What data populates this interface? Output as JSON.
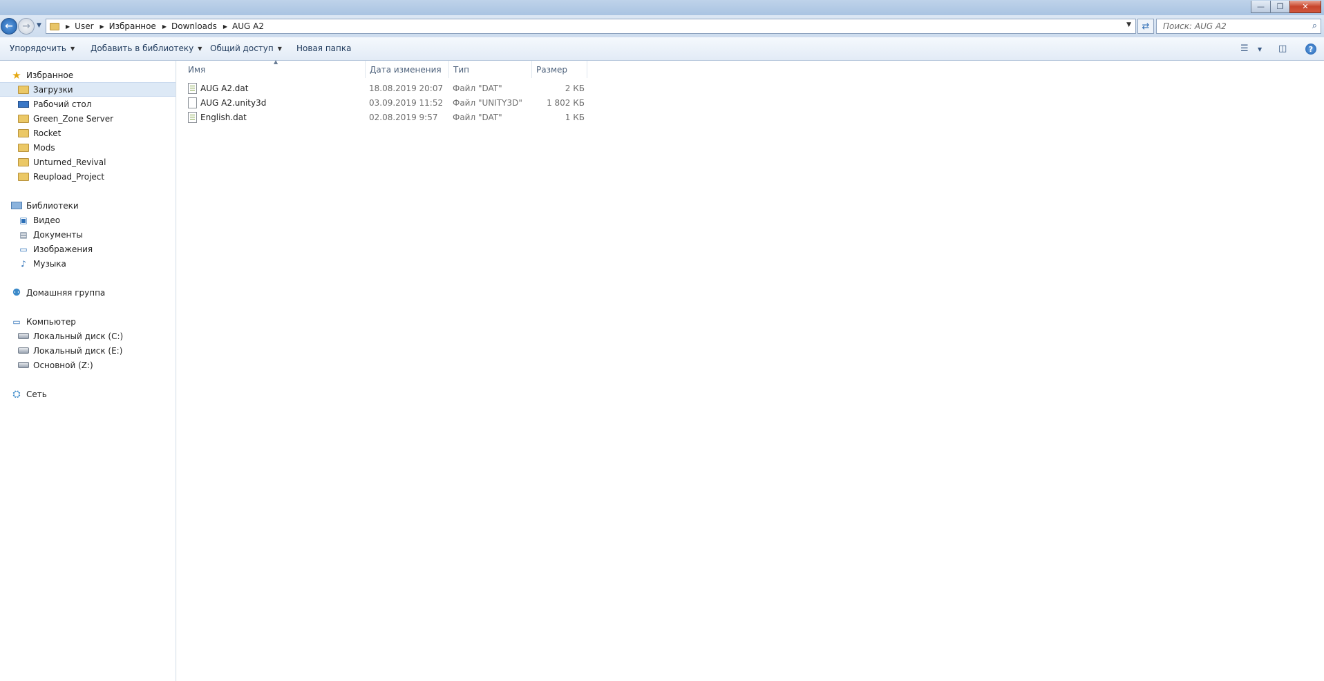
{
  "window": {
    "minimize": "—",
    "maximize": "❐",
    "close": "✕"
  },
  "nav": {
    "back_icon": "arrow-left-icon",
    "forward_icon": "arrow-right-icon",
    "breadcrumbs": [
      "User",
      "Избранное",
      "Downloads",
      "AUG A2"
    ],
    "search_placeholder": "Поиск: AUG A2"
  },
  "toolbar": {
    "organize": "Упорядочить",
    "add_to_library": "Добавить в библиотеку",
    "share": "Общий доступ",
    "new_folder": "Новая папка"
  },
  "sidebar": {
    "favorites": {
      "label": "Избранное",
      "items": [
        "Загрузки",
        "Рабочий стол",
        "Green_Zone Server",
        "Rocket",
        "Mods",
        "Unturned_Revival",
        "Reupload_Project"
      ]
    },
    "libraries": {
      "label": "Библиотеки",
      "items": [
        "Видео",
        "Документы",
        "Изображения",
        "Музыка"
      ]
    },
    "homegroup": {
      "label": "Домашняя группа"
    },
    "computer": {
      "label": "Компьютер",
      "items": [
        "Локальный диск (C:)",
        "Локальный диск (E:)",
        "Основной (Z:)"
      ]
    },
    "network": {
      "label": "Сеть"
    }
  },
  "columns": {
    "name": "Имя",
    "date": "Дата изменения",
    "type": "Тип",
    "size": "Размер"
  },
  "files": [
    {
      "name": "AUG A2.dat",
      "date": "18.08.2019 20:07",
      "type": "Файл \"DAT\"",
      "size": "2 КБ",
      "icon": "text-file-icon"
    },
    {
      "name": "AUG A2.unity3d",
      "date": "03.09.2019 11:52",
      "type": "Файл \"UNITY3D\"",
      "size": "1 802 КБ",
      "icon": "blank-file-icon"
    },
    {
      "name": "English.dat",
      "date": "02.08.2019 9:57",
      "type": "Файл \"DAT\"",
      "size": "1 КБ",
      "icon": "text-file-icon"
    }
  ],
  "colors": {
    "selection": "#dde9f6",
    "toolbar_text": "#1e395b",
    "close_button": "#c8452c"
  }
}
